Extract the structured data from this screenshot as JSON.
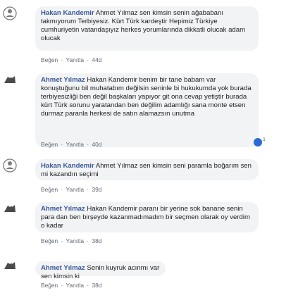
{
  "actions": {
    "like": "Beğen",
    "reply": "Yanıtla",
    "sep": "·"
  },
  "comments": [
    {
      "author": "Hakan Kandemir",
      "text": "Ahmet Yılmaz sen kimsin senin ağababanı takmıyorum Terbiyesiz. Kürt Türk kardeştir Hepimiz Türkiye cumhuriyetin vatandaşıyız herkes yorumlarında dikkatli olucak adam olucak",
      "time": "44d",
      "avatar": "hakan-avatar"
    },
    {
      "author": "Ahmet Yılmaz",
      "text": "Hakan Kandemir benim bir tane babam var konuştuğunu bil muhatabım değilsin seninle bi hukukumda yok burada terbiyesizliği ben değil başkaları yapıyor git ona cevap yetiştir burada kürt Türk sorunu yaratandan ben değilim adamlığı sana monte etsen durmaz paranla herkesi de satın alamazsın unutma",
      "time": "40d",
      "avatar": "ahmet-avatar",
      "reaction": {
        "count": "1",
        "color": "#2b69d6"
      }
    },
    {
      "author": "Hakan Kandemir",
      "text": "Ahmet Yılmaz sen kimsin seni paramla boğarım sen mi kazandın seçimi",
      "time": "39d",
      "avatar": "hakan-avatar"
    },
    {
      "author": "Ahmet Yılmaz",
      "text": "Hakan Kandemir paranı bir yerine sok banane senin para dan ben birşeyde kazanmadımadım bir seçmen olarak oy verdim o kadar",
      "time": "38d",
      "avatar": "ahmet-avatar"
    },
    {
      "author": "Ahmet Yılmaz",
      "text": "Senin kuyruk acınmı var sen kimsin ki",
      "time": "38d",
      "avatar": "ahmet-avatar"
    }
  ]
}
